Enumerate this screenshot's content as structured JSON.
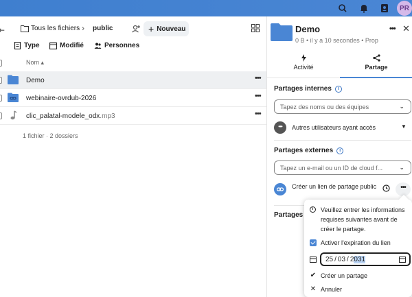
{
  "topbar": {
    "avatar_initials": "PR",
    "icons": [
      "search-icon",
      "bell-icon",
      "contacts-icon"
    ],
    "color": "#4a86d4"
  },
  "breadcrumb": {
    "home": "Tous les fichiers",
    "current": "public"
  },
  "toolbar": {
    "new_label": "Nouveau"
  },
  "filters": {
    "type": "Type",
    "modified": "Modifié",
    "people": "Personnes"
  },
  "list": {
    "column_name": "Nom",
    "rows": [
      {
        "name": "Demo",
        "ext": "",
        "icon": "folder-icon"
      },
      {
        "name": "webinaire-ovrdub-2026",
        "ext": "",
        "icon": "link-folder-icon"
      },
      {
        "name": "clic_palatal-modele_odx",
        "ext": ".mp3",
        "icon": "audio-file-icon"
      }
    ],
    "summary": "1 fichier · 2 dossiers"
  },
  "sidebar": {
    "title": "Demo",
    "meta": "0 B  •  il y a 10 secondes  •  Prop",
    "tabs": [
      {
        "label": "Activité"
      },
      {
        "label": "Partage"
      }
    ],
    "internal": {
      "title": "Partages internes",
      "placeholder": "Tapez des noms ou des équipes",
      "other_users": "Autres utilisateurs ayant accès"
    },
    "external": {
      "title": "Partages externes",
      "placeholder": "Tapez un e-mail ou un ID de cloud f...",
      "create_link": "Créer un lien de partage public"
    },
    "truncated_section": "Partages s"
  },
  "popover": {
    "info": "Veuillez entrer les informations requises suivantes avant de créer le partage.",
    "expiration_label": "Activer l'expiration du lien",
    "date": {
      "day": "25",
      "month": "03",
      "year_prefix": "2",
      "year_selected": "031"
    },
    "create": "Créer un partage",
    "cancel": "Annuler"
  }
}
